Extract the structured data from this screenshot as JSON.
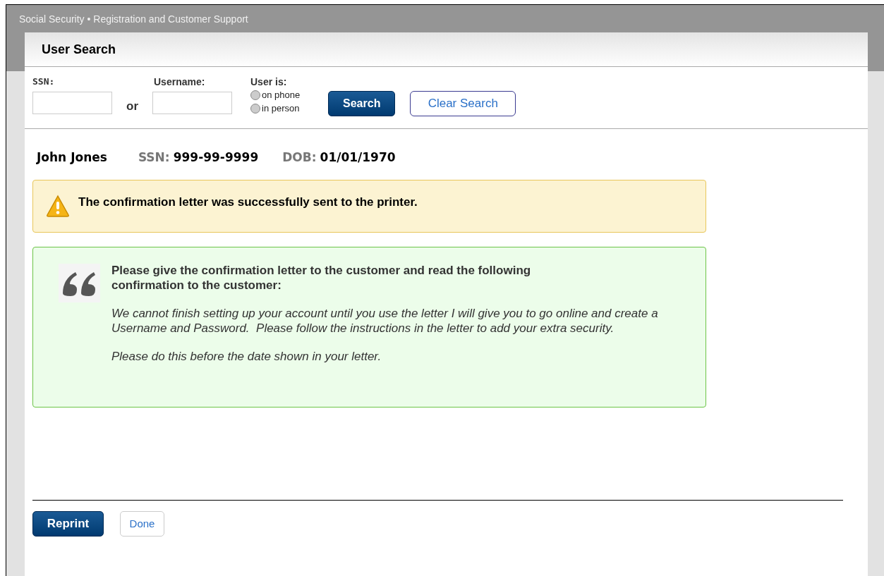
{
  "header": {
    "title": "Social Security • Registration and Customer Support"
  },
  "panel": {
    "title": "User Search"
  },
  "search": {
    "ssn_label": "SSN:",
    "or_label": "or",
    "username_label": "Username:",
    "user_is_label": "User is:",
    "options": [
      {
        "label": "on phone",
        "selected": false
      },
      {
        "label": "in person",
        "selected": false
      }
    ],
    "search_button": "Search",
    "clear_button": "Clear Search"
  },
  "person": {
    "name": "John Jones",
    "ssn_label": "SSN:",
    "ssn": "999-99-9999",
    "dob_label": "DOB:",
    "dob": "01/01/1970"
  },
  "warning": {
    "message": "The confirmation letter was successfully sent to the printer."
  },
  "script_box": {
    "instruction": "Please give the confirmation letter to the customer and read the following confirmation to the customer:",
    "paragraphs": [
      "We cannot finish setting up your account until you use the letter I will give you to go online and create a Username and Password.  Please follow the instructions in the letter to add your extra security.",
      "Please do this before the date shown in your letter."
    ]
  },
  "actions": {
    "reprint": "Reprint",
    "done": "Done"
  }
}
